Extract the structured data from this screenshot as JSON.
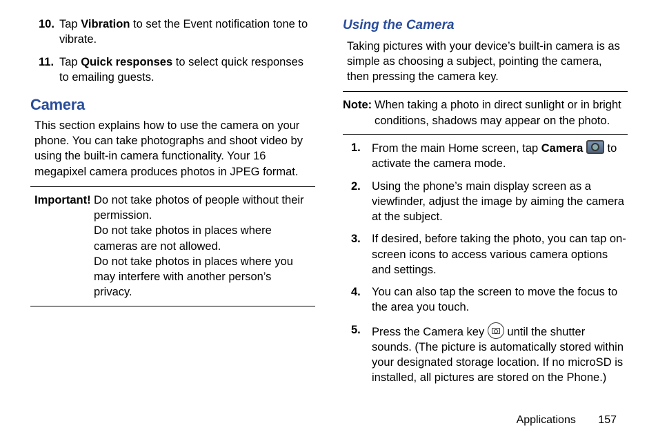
{
  "left": {
    "steps": [
      {
        "n": "10.",
        "pre": "Tap ",
        "bold": "Vibration",
        "post": " to set the Event notification tone to vibrate."
      },
      {
        "n": "11.",
        "pre": "Tap ",
        "bold": "Quick responses",
        "post": " to select quick responses to emailing guests."
      }
    ],
    "camera_heading": "Camera",
    "camera_intro": "This section explains how to use the camera on your phone. You can take photographs and shoot video by using the built-in camera functionality. Your 16 megapixel camera produces photos in JPEG format.",
    "important_label": "Important!",
    "important_lines": [
      "Do not take photos of people without their permission.",
      "Do not take photos in places where cameras are not allowed.",
      "Do not take photos in places where you may interfere with another person’s privacy."
    ]
  },
  "right": {
    "using_heading": "Using the Camera",
    "using_intro": "Taking pictures with your device’s built-in camera is as simple as choosing a subject, pointing the camera, then pressing the camera key.",
    "note_label": "Note:",
    "note_text": "When taking a photo in direct sunlight or in bright conditions, shadows may appear on the photo.",
    "steps": [
      {
        "n": "1.",
        "pre": "From the main Home screen, tap ",
        "bold": "Camera",
        "post_after_icon": " to activate the camera mode.",
        "icon": "camera-app"
      },
      {
        "n": "2.",
        "text": "Using the phone’s main display screen as a viewfinder, adjust the image by aiming the camera at the subject."
      },
      {
        "n": "3.",
        "text": "If desired, before taking the photo, you can tap on-screen icons to access various camera options and settings."
      },
      {
        "n": "4.",
        "text": "You can also tap the screen to move the focus to the area you touch."
      },
      {
        "n": "5.",
        "pre": "Press the Camera key ",
        "icon": "camera-key",
        "post_after_icon": " until the shutter sounds. (The picture is automatically stored within your designated storage location. If no microSD is installed, all pictures are stored on the Phone.)"
      }
    ]
  },
  "footer": {
    "section": "Applications",
    "page": "157"
  }
}
